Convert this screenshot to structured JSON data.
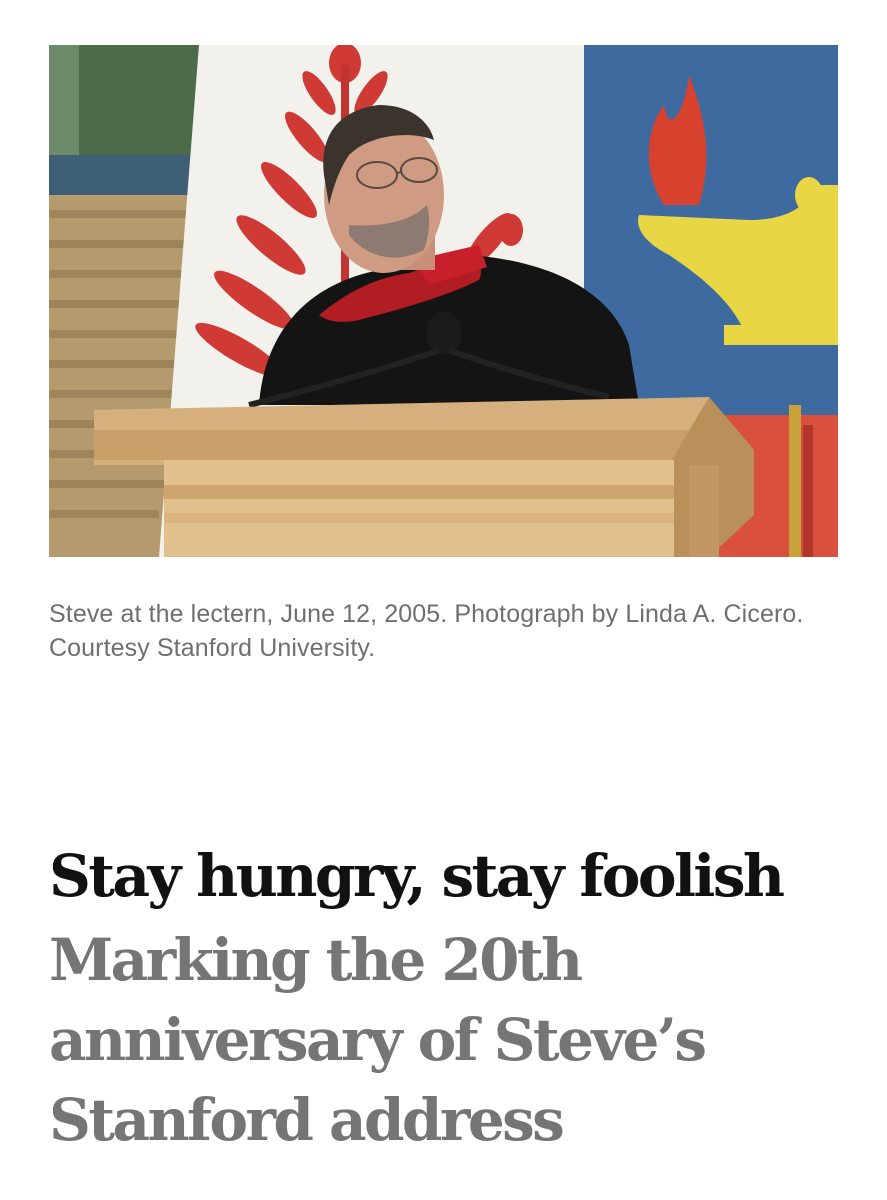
{
  "photo": {
    "alt": "Steve at the lectern, June 12, 2005. Photograph by Linda A. Cicero. Courtesy Stanford University."
  },
  "caption": "Steve at the lectern, June 12, 2005. Photograph by Linda A. Cicero. Courtesy Stanford University.",
  "title": "Stay hungry, stay foolish",
  "subtitle": "Marking the 20th anniversary of Steve’s Stanford address"
}
